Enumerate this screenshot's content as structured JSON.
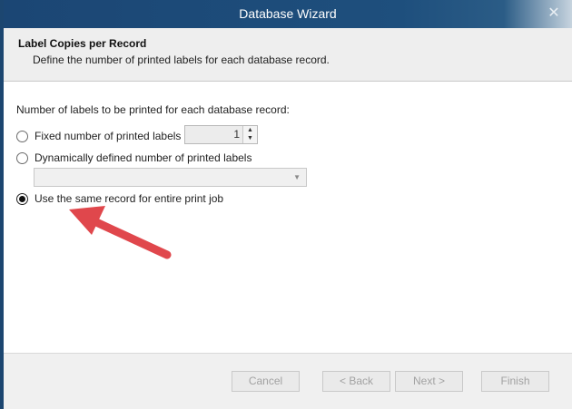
{
  "window": {
    "title": "Database Wizard"
  },
  "header": {
    "title": "Label Copies per Record",
    "subtitle": "Define the number of printed labels for each database record."
  },
  "content": {
    "prompt": "Number of labels to be printed for each database record:",
    "options": [
      {
        "label": "Fixed number of printed labels",
        "selected": false
      },
      {
        "label": "Dynamically defined number of printed labels",
        "selected": false
      },
      {
        "label": "Use the same record for entire print job",
        "selected": true
      }
    ],
    "fixed_count": "1",
    "dynamic_field": ""
  },
  "buttons": {
    "cancel": "Cancel",
    "back": "< Back",
    "next": "Next >",
    "finish": "Finish"
  },
  "colors": {
    "titlebar": "#1d4b78",
    "annotation_arrow": "#e0474c"
  },
  "icons": {
    "close": "close-icon",
    "spin_up": "chevron-up-icon",
    "spin_down": "chevron-down-icon",
    "dropdown": "dropdown-arrow-icon"
  }
}
